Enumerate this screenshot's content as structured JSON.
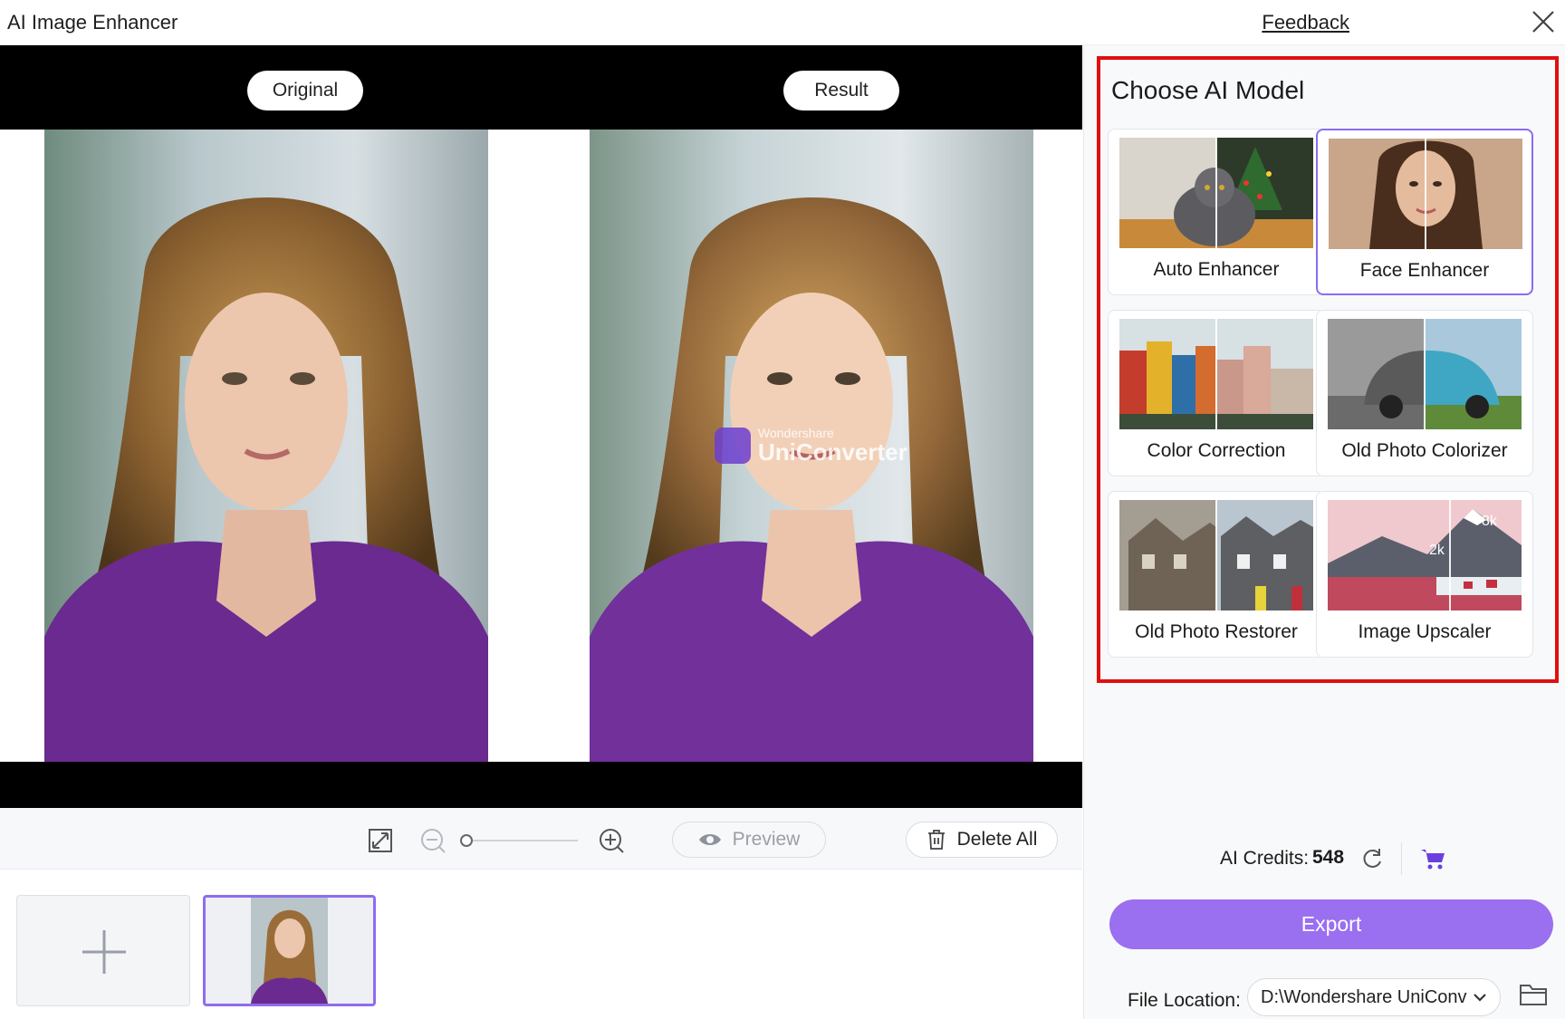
{
  "window": {
    "title": "AI Image Enhancer",
    "feedback_label": "Feedback"
  },
  "preview": {
    "original_label": "Original",
    "result_label": "Result",
    "watermark_brand": "Wondershare",
    "watermark_product": "UniConverter"
  },
  "toolbar": {
    "preview_label": "Preview",
    "delete_all_label": "Delete All",
    "zoom_level": 0
  },
  "panel": {
    "title": "Choose AI Model",
    "models": [
      {
        "label": "Auto Enhancer",
        "selected": false
      },
      {
        "label": "Face Enhancer",
        "selected": true
      },
      {
        "label": "Color Correction",
        "selected": false
      },
      {
        "label": "Old Photo Colorizer",
        "selected": false
      },
      {
        "label": "Old Photo Restorer",
        "selected": false
      },
      {
        "label": "Image Upscaler",
        "selected": false
      }
    ],
    "upscaler_badges": [
      "2k",
      "8k"
    ]
  },
  "credits": {
    "label": "AI Credits:",
    "value": "548"
  },
  "export_label": "Export",
  "file_location": {
    "label": "File Location:",
    "value": "D:\\Wondershare UniConv"
  },
  "colors": {
    "accent": "#9a6ff0",
    "selected_border": "#8a6cf2",
    "highlight": "#e01010",
    "shirt": "#6b2a8f"
  }
}
